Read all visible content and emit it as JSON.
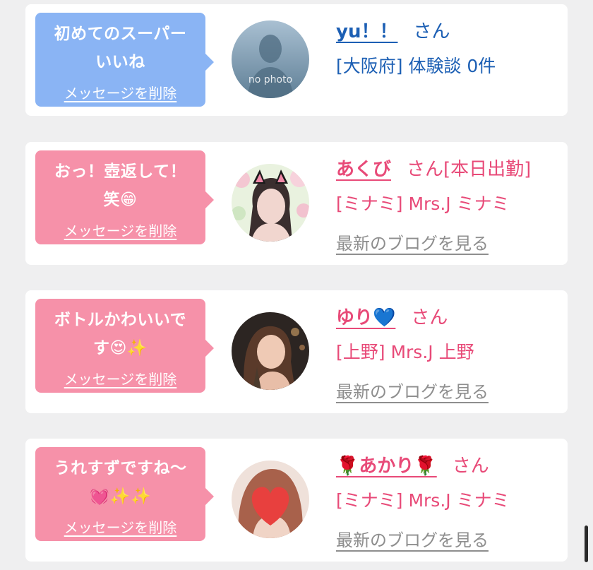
{
  "cards": [
    {
      "bubble_color": "#8ab4f4",
      "message": "初めてのスーパー\nいいね",
      "delete_label": "メッセージを削除",
      "avatar": "no-photo",
      "avatar_text": "no photo",
      "name": "yu！！",
      "suffix": "さん",
      "info": "[大阪府] 体験談 0件",
      "text_color": "#1c5fb4"
    },
    {
      "bubble_color": "#f691a9",
      "message": "おっ！壺返して！\n笑😁",
      "delete_label": "メッセージを削除",
      "avatar": "cat-ear-photo",
      "name": "あくび",
      "suffix": "さん[本日出勤]",
      "info": "[ミナミ] Mrs.J ミナミ",
      "blog_label": "最新のブログを見る",
      "text_color": "#e84a78"
    },
    {
      "bubble_color": "#f691a9",
      "message": "ボトルかわいいで\nす😍✨",
      "delete_label": "メッセージを削除",
      "avatar": "portrait-photo",
      "name": "ゆり💙",
      "suffix": "さん",
      "info": "[上野] Mrs.J 上野",
      "blog_label": "最新のブログを見る",
      "text_color": "#e84a78"
    },
    {
      "bubble_color": "#f691a9",
      "message": "うれすずですね〜\n💓✨✨",
      "delete_label": "メッセージを削除",
      "avatar": "heart-covered-photo",
      "name": "🌹あかり🌹",
      "suffix": "さん",
      "info": "[ミナミ] Mrs.J ミナミ",
      "blog_label": "最新のブログを見る",
      "text_color": "#e84a78"
    }
  ]
}
